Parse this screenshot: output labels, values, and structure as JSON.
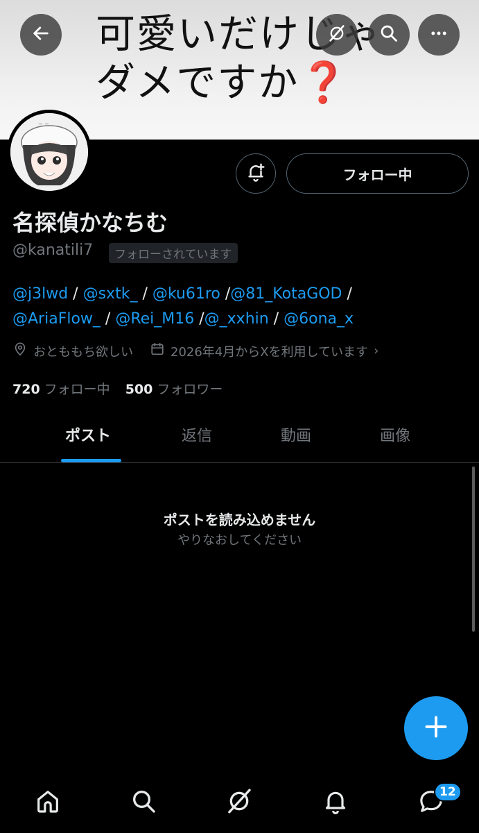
{
  "banner": {
    "line1": "可愛いだけじゃ",
    "line2": "ダメですか",
    "question_mark": "❓"
  },
  "header": {
    "back_icon": "back-arrow-icon",
    "grok_icon": "grok-icon",
    "search_icon": "search-icon",
    "more_icon": "more-horizontal-icon"
  },
  "profile": {
    "display_name": "名探偵かなちむ",
    "handle": "@kanatili7",
    "follows_you": "フォローされています",
    "follow_button": "フォロー中",
    "bio_mentions": [
      "@j3lwd",
      "@sxtk_",
      "@ku61ro",
      "@81_KotaGOD",
      "@AriaFlow_",
      "@Rei_M16",
      "@_xxhin",
      "@6ona_x"
    ],
    "location": "おとももち欲しい",
    "joined": "2026年4月からXを利用しています",
    "following_count": "720",
    "following_label": "フォロー中",
    "followers_count": "500",
    "followers_label": "フォロワー"
  },
  "tabs": [
    "ポスト",
    "返信",
    "動画",
    "画像"
  ],
  "active_tab": "ポスト",
  "empty_state": {
    "title": "ポストを読み込めません",
    "subtitle": "やりなおしてください"
  },
  "nav": {
    "messages_badge": "12"
  },
  "colors": {
    "accent": "#1d9bf0",
    "background": "#000000",
    "muted_text": "#71767b"
  }
}
